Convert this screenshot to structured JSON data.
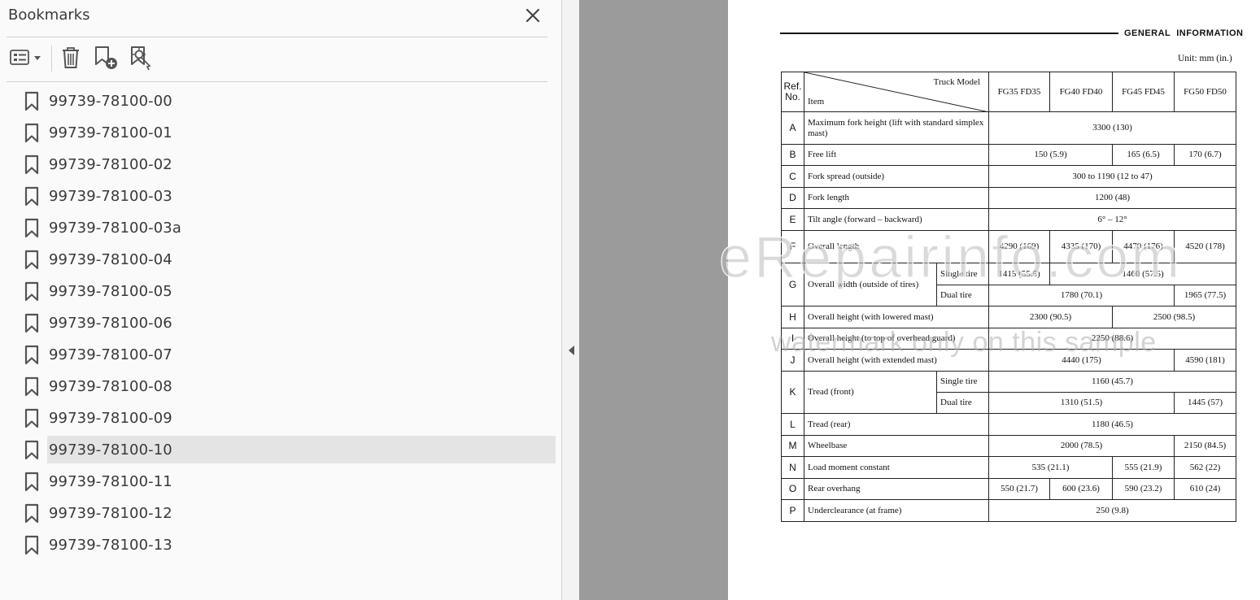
{
  "panel": {
    "title": "Bookmarks",
    "selected_index": 11,
    "bookmarks": [
      "99739-78100-00",
      "99739-78100-01",
      "99739-78100-02",
      "99739-78100-03",
      "99739-78100-03a",
      "99739-78100-04",
      "99739-78100-05",
      "99739-78100-06",
      "99739-78100-07",
      "99739-78100-08",
      "99739-78100-09",
      "99739-78100-10",
      "99739-78100-11",
      "99739-78100-12",
      "99739-78100-13"
    ]
  },
  "toolbar": {
    "icons": [
      "bookmark-options-icon",
      "delete-bookmark-icon",
      "new-bookmark-icon",
      "bookmark-from-selection-icon"
    ]
  },
  "colors": {
    "panel_bg": "#fafafa",
    "selected_row": "#e4e4e4",
    "gray_area": "#9b9b9b",
    "text": "#3a3a3a"
  },
  "document": {
    "section_title": "GENERAL  INFORMATION",
    "units": "Unit:  mm (in.)",
    "table": {
      "ref_header": "Ref. No.",
      "truck_model": "Truck Model",
      "item": "Item",
      "models": [
        "FG35 FD35",
        "FG40 FD40",
        "FG45 FD45",
        "FG50 FD50"
      ],
      "rows": {
        "A": {
          "ref": "A",
          "item": "Maximum fork height (lift with standard simplex mast)",
          "v": "3300 (130)"
        },
        "B": {
          "ref": "B",
          "item": "Free lift",
          "v1": "150 (5.9)",
          "v2": "165 (6.5)",
          "v3": "170 (6.7)"
        },
        "C": {
          "ref": "C",
          "item": "Fork spread (outside)",
          "v": "300 to 1190 (12 to 47)"
        },
        "D": {
          "ref": "D",
          "item": "Fork length",
          "v": "1200 (48)"
        },
        "E": {
          "ref": "E",
          "item": "Tilt angle (forward – backward)",
          "v": "6° – 12°"
        },
        "F": {
          "ref": "F",
          "item": "Overall length",
          "v1": "4290 (169)",
          "v2": "4335 (170)",
          "v3": "4470 (176)",
          "v4": "4520 (178)"
        },
        "G": {
          "ref": "G",
          "item": "Overall width (outside of tires)",
          "sub1": "Single tire",
          "s1": "1415 (55.5)",
          "s2": "1460 (57.5)",
          "sub2": "Dual tire",
          "d1": "1780 (70.1)",
          "d2": "1965 (77.5)"
        },
        "H": {
          "ref": "H",
          "item": "Overall height (with lowered mast)",
          "v1": "2300 (90.5)",
          "v2": "2500 (98.5)"
        },
        "I": {
          "ref": "I",
          "item": "Overall height (to top of overhead guard)",
          "v": "2250 (88.6)"
        },
        "J": {
          "ref": "J",
          "item": "Overall height (with extended mast)",
          "v1": "4440 (175)",
          "v2": "4590 (181)"
        },
        "K": {
          "ref": "K",
          "item": "Tread (front)",
          "sub1": "Single tire",
          "s": "1160 (45.7)",
          "sub2": "Dual tire",
          "d1": "1310 (51.5)",
          "d2": "1445 (57)"
        },
        "L": {
          "ref": "L",
          "item": "Tread (rear)",
          "v": "1180 (46.5)"
        },
        "M": {
          "ref": "M",
          "item": "Wheelbase",
          "v1": "2000 (78.5)",
          "v2": "2150 (84.5)"
        },
        "N": {
          "ref": "N",
          "item": "Load moment constant",
          "v1": "535 (21.1)",
          "v2": "555 (21.9)",
          "v3": "562 (22)"
        },
        "O": {
          "ref": "O",
          "item": "Rear overhang",
          "v1": "550 (21.7)",
          "v2": "600 (23.6)",
          "v3": "590 (23.2)",
          "v4": "610 (24)"
        },
        "P": {
          "ref": "P",
          "item": "Underclearance (at frame)",
          "v": "250 (9.8)"
        }
      }
    }
  },
  "watermark": {
    "main": "eRepairinfo.com",
    "sub": "watermark only on this sample"
  }
}
